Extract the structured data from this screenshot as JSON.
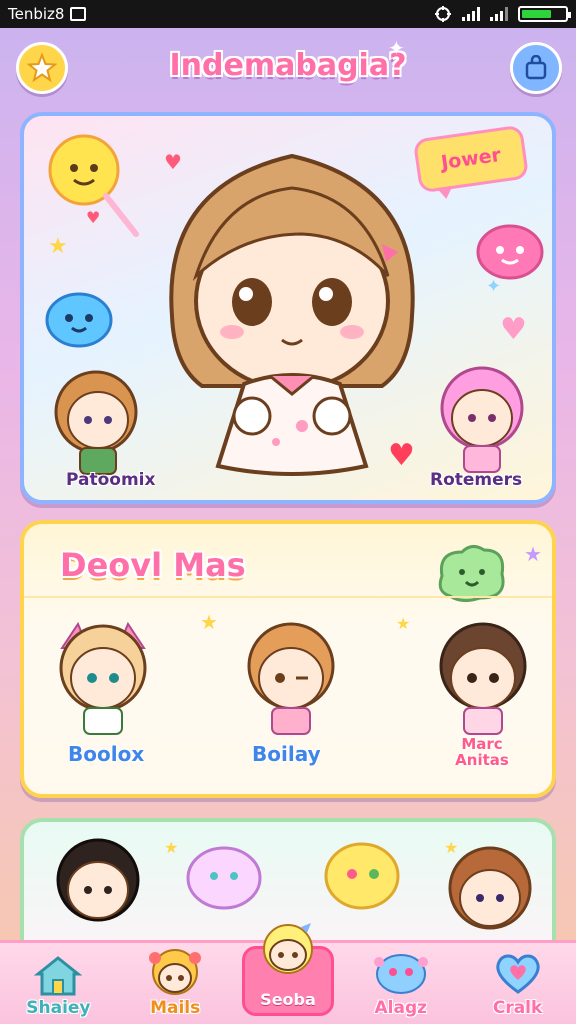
{
  "status_bar": {
    "carrier": "Tenbiz8",
    "icons": [
      "notification-icon",
      "sync-icon",
      "signal-icon",
      "signal-icon",
      "battery-icon"
    ],
    "battery_level": 0.7
  },
  "header": {
    "title": "Indemabagia?",
    "left_button_icon": "star-icon",
    "right_button_icon": "shopping-bag-icon"
  },
  "hero": {
    "tag": "Jower",
    "left_character_label": "Patoomix",
    "right_character_label": "Rotemers"
  },
  "featured": {
    "title": "Deovl Mas",
    "characters": [
      {
        "name": "Boolox"
      },
      {
        "name": "Boilay"
      },
      {
        "name": "Marc\nAnitas"
      }
    ]
  },
  "bottom_nav": {
    "items": [
      {
        "label": "Shaiey",
        "icon": "home-icon",
        "active": false
      },
      {
        "label": "Mails",
        "icon": "character-icon",
        "active": false
      },
      {
        "label": "Seoba",
        "icon": "character-icon",
        "active": true
      },
      {
        "label": "Alagz",
        "icon": "blob-icon",
        "active": false
      },
      {
        "label": "Cralk",
        "icon": "heart-icon",
        "active": false
      }
    ]
  },
  "colors": {
    "accent_pink": "#ff6fa8",
    "accent_blue": "#3f86e8",
    "accent_yellow": "#ffd64a"
  }
}
